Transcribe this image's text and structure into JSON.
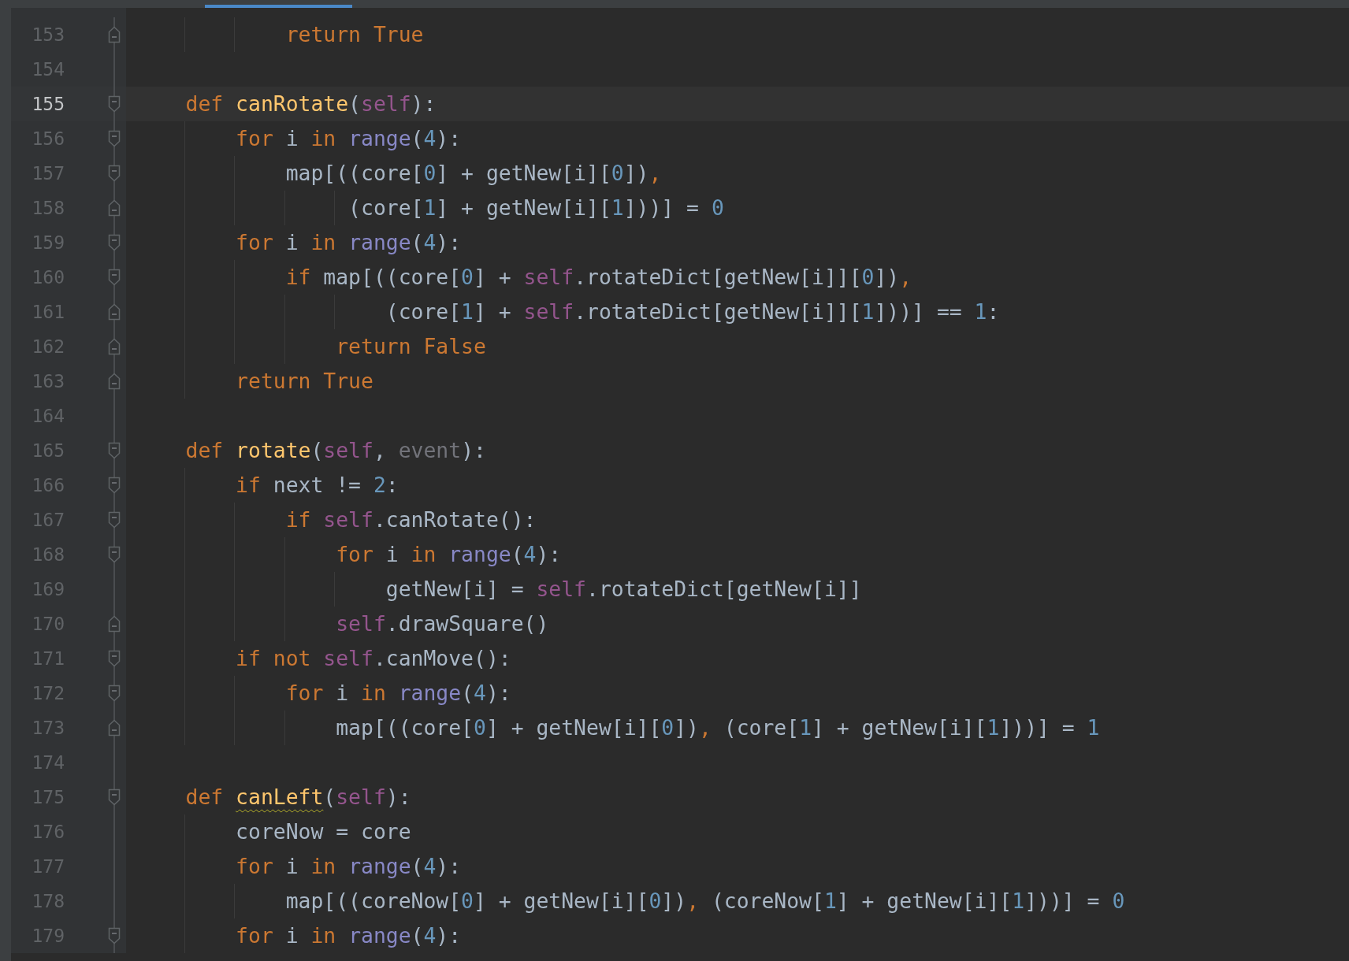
{
  "lines": [
    {
      "number": "153",
      "fold": {
        "kind": "end"
      },
      "current": false,
      "tokens": [
        {
          "kind": "k",
          "s": "            return True"
        }
      ]
    },
    {
      "number": "154",
      "current": false
    },
    {
      "number": "155",
      "fold": {
        "kind": "start"
      },
      "current": true,
      "tokens": [
        {
          "kind": "k",
          "s": "    def "
        },
        {
          "kind": "f",
          "s": "canRotate"
        },
        {
          "kind": "t",
          "s": "("
        },
        {
          "kind": "s",
          "s": "self"
        },
        {
          "kind": "t",
          "s": "):"
        }
      ]
    },
    {
      "number": "156",
      "fold": {
        "kind": "start"
      },
      "current": false,
      "tokens": [
        {
          "kind": "k",
          "s": "        for "
        },
        {
          "kind": "t",
          "s": "i "
        },
        {
          "kind": "k",
          "s": "in "
        },
        {
          "kind": "b",
          "s": "range"
        },
        {
          "kind": "t",
          "s": "("
        },
        {
          "kind": "n",
          "s": "4"
        },
        {
          "kind": "t",
          "s": "):"
        }
      ]
    },
    {
      "number": "157",
      "fold": {
        "kind": "start"
      },
      "current": false,
      "tokens": [
        {
          "kind": "t",
          "s": "            map[((core["
        },
        {
          "kind": "n",
          "s": "0"
        },
        {
          "kind": "t",
          "s": "] + getNew[i]["
        },
        {
          "kind": "n",
          "s": "0"
        },
        {
          "kind": "t",
          "s": "])"
        },
        {
          "kind": "k",
          "s": ","
        }
      ]
    },
    {
      "number": "158",
      "fold": {
        "kind": "end"
      },
      "current": false,
      "tokens": [
        {
          "kind": "t",
          "s": "                 (core["
        },
        {
          "kind": "n",
          "s": "1"
        },
        {
          "kind": "t",
          "s": "] + getNew[i]["
        },
        {
          "kind": "n",
          "s": "1"
        },
        {
          "kind": "t",
          "s": "]))] = "
        },
        {
          "kind": "n",
          "s": "0"
        }
      ]
    },
    {
      "number": "159",
      "fold": {
        "kind": "start"
      },
      "current": false,
      "tokens": [
        {
          "kind": "k",
          "s": "        for "
        },
        {
          "kind": "t",
          "s": "i "
        },
        {
          "kind": "k",
          "s": "in "
        },
        {
          "kind": "b",
          "s": "range"
        },
        {
          "kind": "t",
          "s": "("
        },
        {
          "kind": "n",
          "s": "4"
        },
        {
          "kind": "t",
          "s": "):"
        }
      ]
    },
    {
      "number": "160",
      "fold": {
        "kind": "start"
      },
      "current": false,
      "tokens": [
        {
          "kind": "k",
          "s": "            if "
        },
        {
          "kind": "t",
          "s": "map[((core["
        },
        {
          "kind": "n",
          "s": "0"
        },
        {
          "kind": "t",
          "s": "] + "
        },
        {
          "kind": "s",
          "s": "self"
        },
        {
          "kind": "t",
          "s": ".rotateDict[getNew[i]]["
        },
        {
          "kind": "n",
          "s": "0"
        },
        {
          "kind": "t",
          "s": "])"
        },
        {
          "kind": "k",
          "s": ","
        }
      ]
    },
    {
      "number": "161",
      "fold": {
        "kind": "end"
      },
      "current": false,
      "tokens": [
        {
          "kind": "t",
          "s": "                    (core["
        },
        {
          "kind": "n",
          "s": "1"
        },
        {
          "kind": "t",
          "s": "] + "
        },
        {
          "kind": "s",
          "s": "self"
        },
        {
          "kind": "t",
          "s": ".rotateDict[getNew[i]]["
        },
        {
          "kind": "n",
          "s": "1"
        },
        {
          "kind": "t",
          "s": "]))] == "
        },
        {
          "kind": "n",
          "s": "1"
        },
        {
          "kind": "t",
          "s": ":"
        }
      ]
    },
    {
      "number": "162",
      "fold": {
        "kind": "end"
      },
      "current": false,
      "tokens": [
        {
          "kind": "k",
          "s": "                return False"
        }
      ]
    },
    {
      "number": "163",
      "fold": {
        "kind": "end"
      },
      "current": false,
      "tokens": [
        {
          "kind": "k",
          "s": "        return True"
        }
      ]
    },
    {
      "number": "164",
      "current": false
    },
    {
      "number": "165",
      "fold": {
        "kind": "start"
      },
      "current": false,
      "tokens": [
        {
          "kind": "k",
          "s": "    def "
        },
        {
          "kind": "f",
          "s": "rotate"
        },
        {
          "kind": "t",
          "s": "("
        },
        {
          "kind": "s",
          "s": "self"
        },
        {
          "kind": "t",
          "s": ", "
        },
        {
          "kind": "p",
          "s": "event"
        },
        {
          "kind": "t",
          "s": "):"
        }
      ]
    },
    {
      "number": "166",
      "fold": {
        "kind": "start"
      },
      "current": false,
      "tokens": [
        {
          "kind": "k",
          "s": "        if "
        },
        {
          "kind": "t",
          "s": "next != "
        },
        {
          "kind": "n",
          "s": "2"
        },
        {
          "kind": "t",
          "s": ":"
        }
      ]
    },
    {
      "number": "167",
      "fold": {
        "kind": "start"
      },
      "current": false,
      "tokens": [
        {
          "kind": "k",
          "s": "            if "
        },
        {
          "kind": "s",
          "s": "self"
        },
        {
          "kind": "t",
          "s": ".canRotate():"
        }
      ]
    },
    {
      "number": "168",
      "fold": {
        "kind": "start"
      },
      "current": false,
      "tokens": [
        {
          "kind": "k",
          "s": "                for "
        },
        {
          "kind": "t",
          "s": "i "
        },
        {
          "kind": "k",
          "s": "in "
        },
        {
          "kind": "b",
          "s": "range"
        },
        {
          "kind": "t",
          "s": "("
        },
        {
          "kind": "n",
          "s": "4"
        },
        {
          "kind": "t",
          "s": "):"
        }
      ]
    },
    {
      "number": "169",
      "current": false,
      "tokens": [
        {
          "kind": "t",
          "s": "                    getNew[i] = "
        },
        {
          "kind": "s",
          "s": "self"
        },
        {
          "kind": "t",
          "s": ".rotateDict[getNew[i]]"
        }
      ]
    },
    {
      "number": "170",
      "fold": {
        "kind": "end"
      },
      "current": false,
      "tokens": [
        {
          "kind": "s",
          "s": "                self"
        },
        {
          "kind": "t",
          "s": ".drawSquare()"
        }
      ]
    },
    {
      "number": "171",
      "fold": {
        "kind": "start"
      },
      "current": false,
      "tokens": [
        {
          "kind": "k",
          "s": "        if not "
        },
        {
          "kind": "s",
          "s": "self"
        },
        {
          "kind": "t",
          "s": ".canMove():"
        }
      ]
    },
    {
      "number": "172",
      "fold": {
        "kind": "start"
      },
      "current": false,
      "tokens": [
        {
          "kind": "k",
          "s": "            for "
        },
        {
          "kind": "t",
          "s": "i "
        },
        {
          "kind": "k",
          "s": "in "
        },
        {
          "kind": "b",
          "s": "range"
        },
        {
          "kind": "t",
          "s": "("
        },
        {
          "kind": "n",
          "s": "4"
        },
        {
          "kind": "t",
          "s": "):"
        }
      ]
    },
    {
      "number": "173",
      "fold": {
        "kind": "end"
      },
      "current": false,
      "tokens": [
        {
          "kind": "t",
          "s": "                map[((core["
        },
        {
          "kind": "n",
          "s": "0"
        },
        {
          "kind": "t",
          "s": "] + getNew[i]["
        },
        {
          "kind": "n",
          "s": "0"
        },
        {
          "kind": "t",
          "s": "])"
        },
        {
          "kind": "k",
          "s": ","
        },
        {
          "kind": "t",
          "s": " (core["
        },
        {
          "kind": "n",
          "s": "1"
        },
        {
          "kind": "t",
          "s": "] + getNew[i]["
        },
        {
          "kind": "n",
          "s": "1"
        },
        {
          "kind": "t",
          "s": "]))] = "
        },
        {
          "kind": "n",
          "s": "1"
        }
      ]
    },
    {
      "number": "174",
      "current": false
    },
    {
      "number": "175",
      "fold": {
        "kind": "start"
      },
      "current": false,
      "tokens": [
        {
          "kind": "k",
          "s": "    def "
        },
        {
          "kind": "f",
          "s": "canLeft",
          "warning": true
        },
        {
          "kind": "t",
          "s": "("
        },
        {
          "kind": "s",
          "s": "self"
        },
        {
          "kind": "t",
          "s": "):"
        }
      ]
    },
    {
      "number": "176",
      "current": false,
      "tokens": [
        {
          "kind": "t",
          "s": "        coreNow = core"
        }
      ]
    },
    {
      "number": "177",
      "current": false,
      "tokens": [
        {
          "kind": "k",
          "s": "        for "
        },
        {
          "kind": "t",
          "s": "i "
        },
        {
          "kind": "k",
          "s": "in "
        },
        {
          "kind": "b",
          "s": "range"
        },
        {
          "kind": "t",
          "s": "("
        },
        {
          "kind": "n",
          "s": "4"
        },
        {
          "kind": "t",
          "s": "):"
        }
      ]
    },
    {
      "number": "178",
      "current": false,
      "tokens": [
        {
          "kind": "t",
          "s": "            map[((coreNow["
        },
        {
          "kind": "n",
          "s": "0"
        },
        {
          "kind": "t",
          "s": "] + getNew[i]["
        },
        {
          "kind": "n",
          "s": "0"
        },
        {
          "kind": "t",
          "s": "])"
        },
        {
          "kind": "k",
          "s": ","
        },
        {
          "kind": "t",
          "s": " (coreNow["
        },
        {
          "kind": "n",
          "s": "1"
        },
        {
          "kind": "t",
          "s": "] + getNew[i]["
        },
        {
          "kind": "n",
          "s": "1"
        },
        {
          "kind": "t",
          "s": "]))] = "
        },
        {
          "kind": "n",
          "s": "0"
        }
      ]
    },
    {
      "number": "179",
      "fold": {
        "kind": "start"
      },
      "current": false,
      "tokens": [
        {
          "kind": "k",
          "s": "        for "
        },
        {
          "kind": "t",
          "s": "i "
        },
        {
          "kind": "k",
          "s": "in "
        },
        {
          "kind": "b",
          "s": "range"
        },
        {
          "kind": "t",
          "s": "("
        },
        {
          "kind": "n",
          "s": "4"
        },
        {
          "kind": "t",
          "s": "):"
        }
      ]
    }
  ]
}
